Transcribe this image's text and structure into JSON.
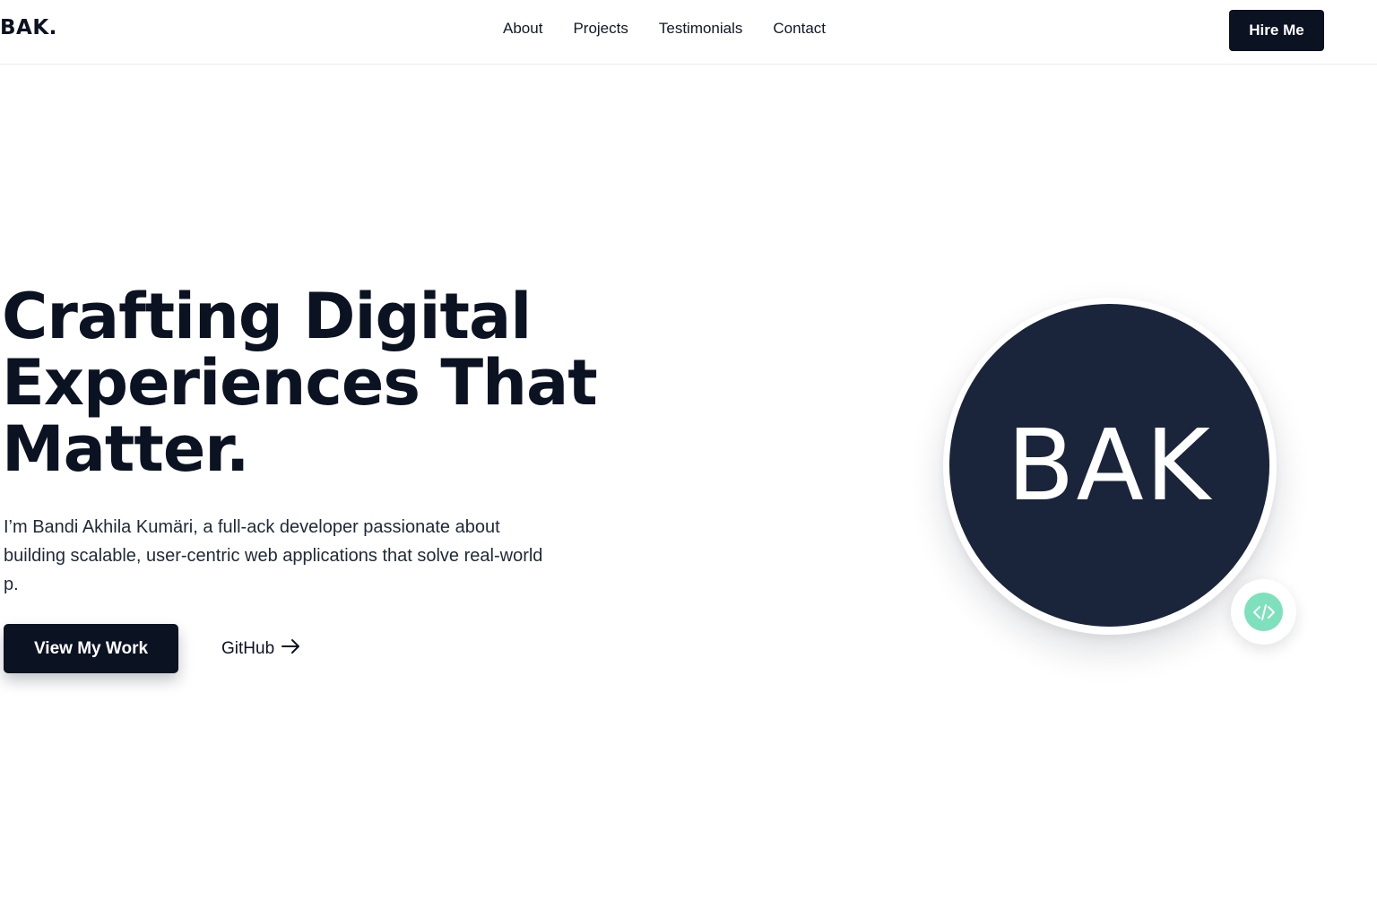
{
  "brand": {
    "logo": "BAK."
  },
  "nav": {
    "links": [
      "About",
      "Projects",
      "Testimonials",
      "Contact"
    ],
    "hire_label": "Hire Me"
  },
  "hero": {
    "title_lines": [
      "Crafting Digital",
      "Experiences That",
      "Matter."
    ],
    "description": "I’m Bandi Akhila Kumäri, a full-ack developer passionate about building scalable, user-centric web applications that solve real-world p.",
    "primary_cta": "View My Work",
    "secondary_cta": "GitHub",
    "secondary_icon": "arrow-right-icon"
  },
  "avatar": {
    "initials": "BAK",
    "background_color": "#1a253b",
    "badge_icon": "code-icon",
    "badge_color": "#7ee0bc"
  },
  "colors": {
    "primary": "#0b1222",
    "background": "#ffffff"
  }
}
